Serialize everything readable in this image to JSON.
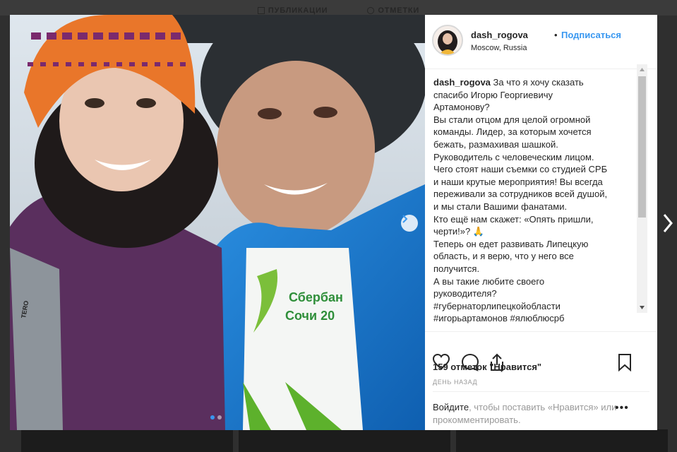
{
  "background_tabs": {
    "posts": "ПУБЛИКАЦИИ",
    "tagged": "ОТМЕТКИ"
  },
  "post": {
    "username": "dash_rogova",
    "separator": "•",
    "follow_label": "Подписаться",
    "location": "Moscow, Russia",
    "carousel": {
      "slide_count": 2,
      "active_slide": 1
    },
    "caption_user": "dash_rogova",
    "caption_lines": [
      "За что я хочу сказать",
      "спасибо Игорю Георгиевичу",
      "Артамонову?",
      "Вы стали отцом для целой огромной",
      "команды. Лидер, за которым хочется",
      "бежать, размахивая шашкой.",
      "Руководитель с человеческим лицом.",
      "Чего стоят наши съемки со студией СРБ",
      "и наши крутые мероприятия! Вы всегда",
      "переживали за сотрудников всей душой,",
      "и мы стали Вашими фанатами.",
      "Кто ещё нам скажет: «Опять пришли,",
      "черти!»? 🙏",
      "Теперь он едет развивать Липецкую",
      "область, и я верю, что у него все",
      "получится.",
      "А вы такие любите своего",
      "руководителя?",
      "#губернаторлипецкойобласти",
      "#игорьартамонов #ялюблюсрб"
    ],
    "likes_text": "159 отметок \"Нравится\"",
    "time_text": "ДЕНЬ НАЗАД",
    "login_link": "Войдите",
    "login_rest": ", чтобы поставить «Нравится» или прокомментировать.",
    "more_options": "•••"
  },
  "photo_text": {
    "shirt_line1": "Сбербан",
    "shirt_line2": "Сочи 20",
    "bag_label": "TERO"
  },
  "colors": {
    "accent": "#3897f0",
    "text": "#262626",
    "muted": "#999999",
    "overlay": "#2f2f2f"
  },
  "icons": [
    "heart-icon",
    "comment-icon",
    "share-icon",
    "bookmark-icon",
    "chevron-right-icon"
  ]
}
